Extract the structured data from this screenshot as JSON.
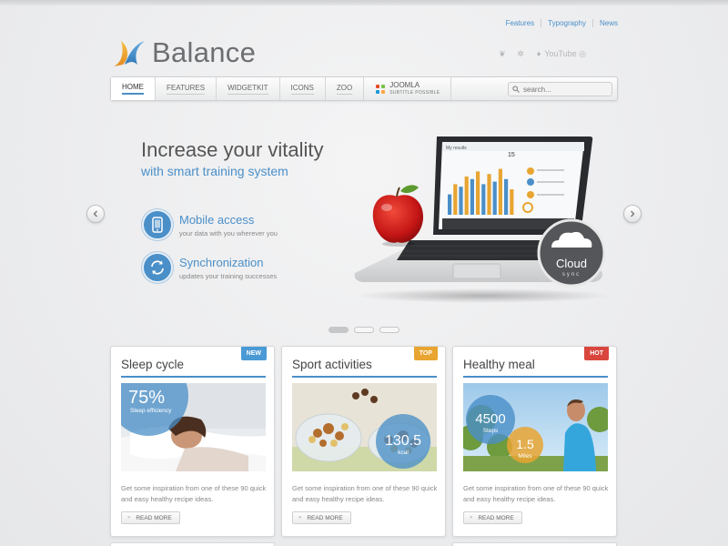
{
  "toplinks": [
    "Features",
    "Typography",
    "News"
  ],
  "logo": {
    "text": "Balance"
  },
  "social_icons": [
    "bird-icon",
    "gear-icon",
    "drop-icon",
    "youtube-icon",
    "globe-icon"
  ],
  "social_labels": {
    "youtube": "YouTube"
  },
  "nav": {
    "items": [
      "HOME",
      "FEATURES",
      "WIDGETKIT",
      "ICONS",
      "ZOO"
    ],
    "joomla_title": "JOOMLA",
    "joomla_subtitle": "SUBTITLE POSSIBLE",
    "search_placeholder": "search..."
  },
  "hero": {
    "title": "Increase your vitality",
    "subtitle": "with smart training system",
    "features": [
      {
        "title": "Mobile access",
        "desc": "your data with you wherever you"
      },
      {
        "title": "Synchronization",
        "desc": "updates your training successes"
      }
    ],
    "cloud_title": "Cloud",
    "cloud_sub": "sync",
    "laptop_header": "My results",
    "laptop_number": "15",
    "slider_dots": 3,
    "active_dot": 0,
    "laptop_bars": [
      0.4,
      0.6,
      0.55,
      0.75,
      0.7,
      0.85,
      0.6,
      0.8,
      0.65,
      0.9,
      0.7,
      0.5
    ]
  },
  "cards": [
    {
      "title": "Sleep cycle",
      "badge": "NEW",
      "badge_color": "#4a9ad6",
      "overlay_value": "75%",
      "overlay_label": "Sleep efficiency",
      "text": "Get some inspiration from one of these 90 quick and easy healthy recipe ideas.",
      "button": "READ MORE"
    },
    {
      "title": "Sport activities",
      "badge": "TOP",
      "badge_color": "#e8a531",
      "overlay_value": "130.5",
      "overlay_label": "kcal",
      "text": "Get some inspiration from one of these 90 quick and easy healthy recipe ideas.",
      "button": "READ MORE"
    },
    {
      "title": "Healthy meal",
      "badge": "HOT",
      "badge_color": "#d9463e",
      "overlay_value": "4500",
      "overlay_label": "Steps",
      "overlay_value2": "1.5",
      "overlay_label2": "Miles",
      "text": "Get some inspiration from one of these 90 quick and easy healthy recipe ideas.",
      "button": "READ MORE"
    }
  ]
}
